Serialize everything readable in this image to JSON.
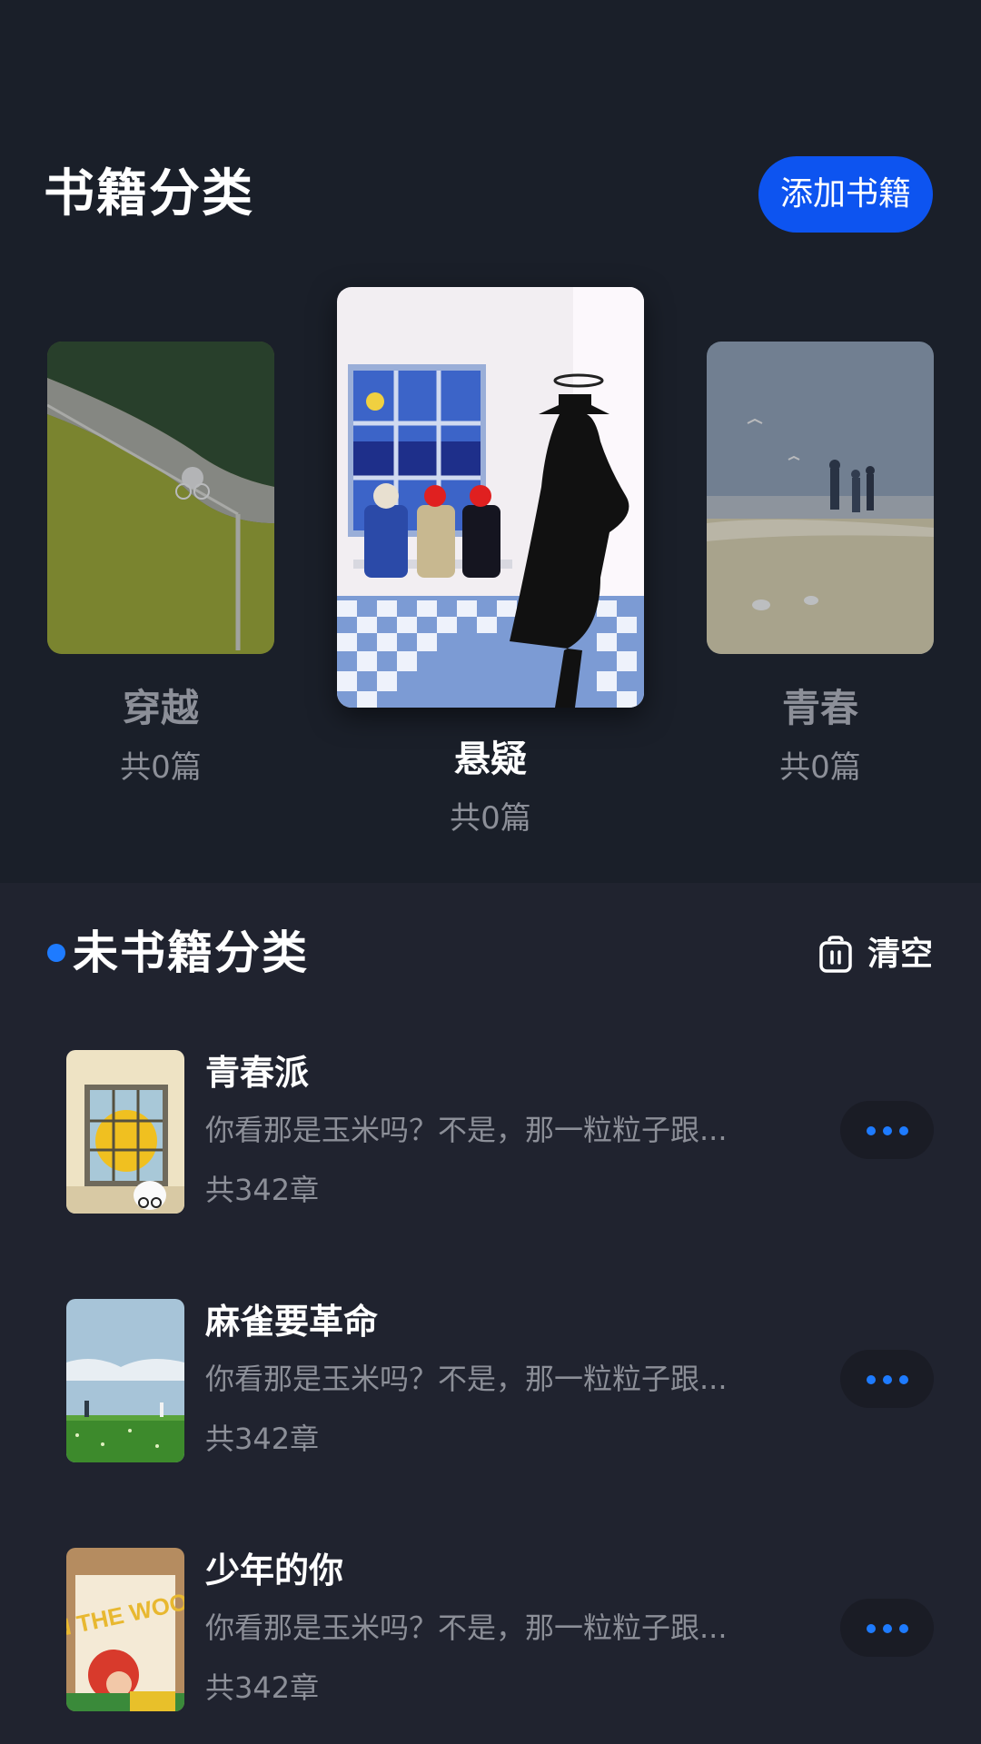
{
  "header": {
    "title": "书籍分类",
    "add_button": "添加书籍"
  },
  "categories": [
    {
      "name": "穿越",
      "count": "共0篇"
    },
    {
      "name": "悬疑",
      "count": "共0篇"
    },
    {
      "name": "青春",
      "count": "共0篇"
    }
  ],
  "uncategorized": {
    "title": "未书籍分类",
    "clear_label": "清空",
    "books": [
      {
        "title": "青春派",
        "desc": "你看那是玉米吗？不是，那一粒粒子跟...",
        "chapters": "共342章"
      },
      {
        "title": "麻雀要革命",
        "desc": "你看那是玉米吗？不是，那一粒粒子跟...",
        "chapters": "共342章"
      },
      {
        "title": "少年的你",
        "desc": "你看那是玉米吗？不是，那一粒粒子跟...",
        "chapters": "共342章",
        "cover_text": "IN THE WOOD"
      }
    ]
  },
  "colors": {
    "background": "#1a1f29",
    "panel": "#20232f",
    "accent": "#0d54f0",
    "dot": "#1e7bff",
    "muted_text": "#8c8f98"
  }
}
